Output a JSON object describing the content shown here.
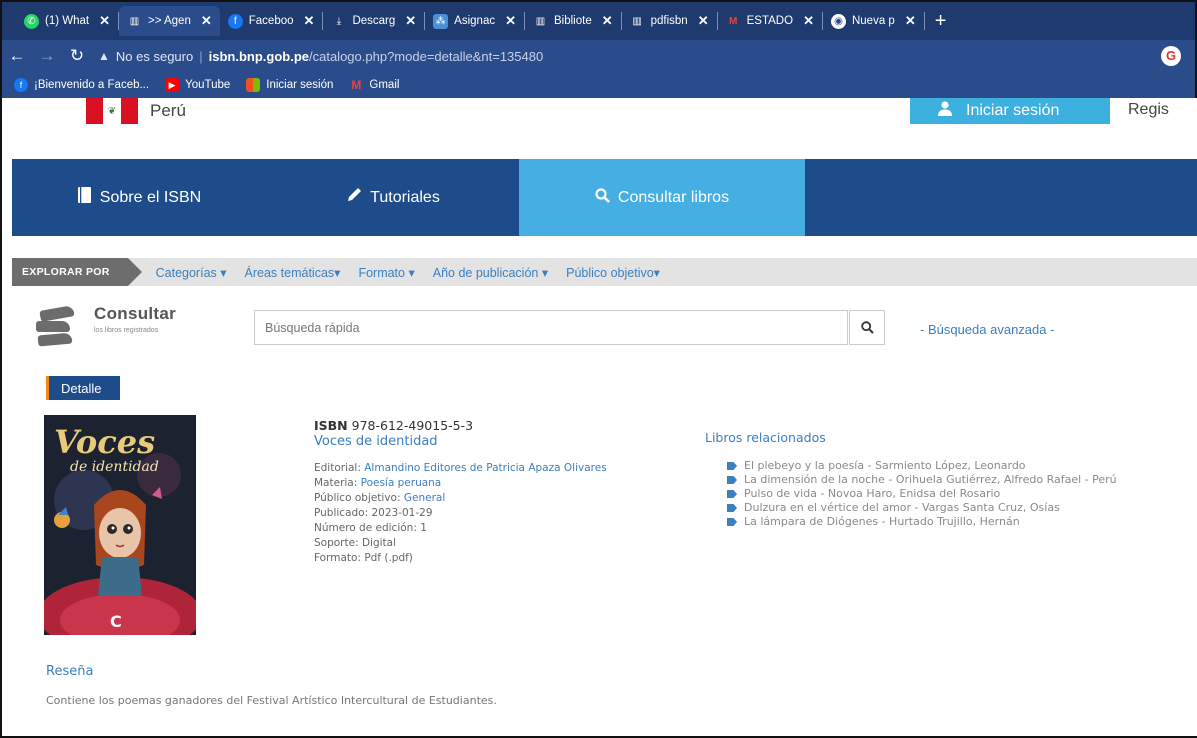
{
  "browser": {
    "tabs": [
      {
        "title": "(1) What",
        "icon": "whatsapp-icon",
        "color": "#25d366",
        "active": false
      },
      {
        "title": ">> Agen",
        "icon": "isbn-logo-icon",
        "color": "#ffffff",
        "active": true
      },
      {
        "title": "Faceboo",
        "icon": "facebook-icon",
        "color": "#1877f2",
        "active": false
      },
      {
        "title": "Descarg",
        "icon": "download-icon",
        "color": "#ffffff",
        "active": false
      },
      {
        "title": "Asignac",
        "icon": "app-icon",
        "color": "#4a8fd8",
        "active": false
      },
      {
        "title": "Bibliote",
        "icon": "isbn-logo-icon",
        "color": "#ffffff",
        "active": false
      },
      {
        "title": "pdfisbn",
        "icon": "isbn-logo-icon",
        "color": "#ffffff",
        "active": false
      },
      {
        "title": "ESTADO",
        "icon": "gmail-icon",
        "color": "#ea4335",
        "active": false
      },
      {
        "title": "Nueva p",
        "icon": "chrome-icon",
        "color": "#ffffff",
        "active": false
      }
    ],
    "new_tab_label": "+",
    "address": {
      "security": "No es seguro",
      "domain": "isbn.bnp.gob.pe",
      "path": "/catalogo.php?mode=detalle&nt=135480"
    },
    "bookmarks": [
      {
        "label": "¡Bienvenido a Faceb...",
        "icon": "facebook-icon",
        "color": "#1877f2"
      },
      {
        "label": "YouTube",
        "icon": "youtube-icon",
        "color": "#ff0000"
      },
      {
        "label": "Iniciar sesión",
        "icon": "microsoft-icon",
        "color": "#f25022"
      },
      {
        "label": "Gmail",
        "icon": "gmail-icon",
        "color": "#ea4335"
      }
    ]
  },
  "site": {
    "country": "Perú",
    "login_label": "Iniciar sesión",
    "register_label": "Regis",
    "nav": [
      {
        "label": "Sobre el ISBN",
        "icon": "book-icon",
        "active": false
      },
      {
        "label": "Tutoriales",
        "icon": "pencil-icon",
        "active": false
      },
      {
        "label": "Consultar libros",
        "icon": "search-icon",
        "active": true
      }
    ],
    "explore": {
      "label": "EXPLORAR POR",
      "links": [
        "Categorías ▾",
        "Áreas temáticas▾",
        "Formato ▾",
        "Año de publicación ▾",
        "Público objetivo▾"
      ]
    },
    "consult": {
      "title": "Consultar",
      "subtitle": "los libros registrados"
    },
    "search": {
      "placeholder": "Búsqueda rápida",
      "advanced_label": "- Búsqueda avanzada -"
    },
    "detail_tab": "Detalle"
  },
  "book": {
    "cover": {
      "title1": "Voces",
      "title2": "de identidad"
    },
    "isbn_label": "ISBN",
    "isbn": "978-612-49015-5-3",
    "title": "Voces de identidad",
    "meta": [
      {
        "label": "Editorial:",
        "value": "Almandino Editores de Patricia Apaza Olivares",
        "link": true
      },
      {
        "label": "Materia:",
        "value": "Poesía peruana",
        "link": true
      },
      {
        "label": "Público objetivo:",
        "value": "General",
        "link": true
      },
      {
        "label": "Publicado:",
        "value": "2023-01-29",
        "link": false
      },
      {
        "label": "Número de edición:",
        "value": "1",
        "link": false
      },
      {
        "label": "Soporte:",
        "value": "Digital",
        "link": false
      },
      {
        "label": "Formato:",
        "value": "Pdf (.pdf)",
        "link": false
      }
    ],
    "review_title": "Reseña",
    "review_text": "Contiene los poemas ganadores del Festival Artístico Intercultural de Estudiantes."
  },
  "related": {
    "title": "Libros relacionados",
    "items": [
      "El plebeyo y la poesía - Sarmiento López, Leonardo",
      "La dimensión de la noche - Orihuela Gutiérrez, Alfredo Rafael - Perú",
      "Pulso de vida - Novoa Haro, Enidsa del Rosario",
      "Dulzura en el vértice del amor - Vargas Santa Cruz, Osías",
      "La lámpara de Diógenes - Hurtado Trujillo, Hernán"
    ]
  }
}
